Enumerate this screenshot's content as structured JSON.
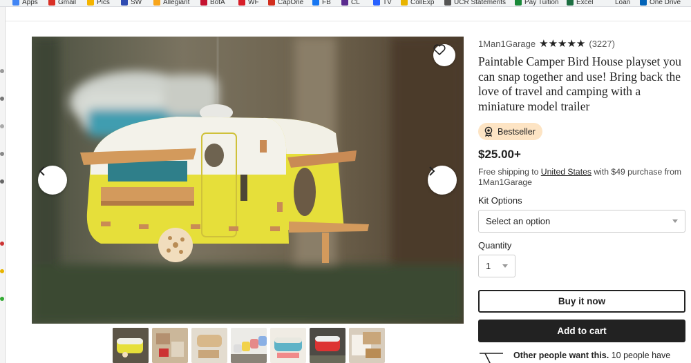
{
  "bookmarks": [
    {
      "label": "Apps",
      "icon": "apps-grid-icon",
      "color": "#4285f4"
    },
    {
      "label": "Gmail",
      "icon": "gmail-icon",
      "color": "#d93025"
    },
    {
      "label": "Pics",
      "icon": "photos-icon",
      "color": "#f4b400"
    },
    {
      "label": "SW",
      "icon": "southwest-heart-icon",
      "color": "#304cb2"
    },
    {
      "label": "Allegiant",
      "icon": "allegiant-sun-icon",
      "color": "#f8a51b"
    },
    {
      "label": "BofA",
      "icon": "bofa-flag-icon",
      "color": "#c41230"
    },
    {
      "label": "WF",
      "icon": "wf-icon",
      "color": "#d71e28"
    },
    {
      "label": "CapOne",
      "icon": "capone-swoosh-icon",
      "color": "#d22e1e"
    },
    {
      "label": "FB",
      "icon": "facebook-icon",
      "color": "#1877f2"
    },
    {
      "label": "CL",
      "icon": "peace-icon",
      "color": "#5b2c8f"
    },
    {
      "label": "TV",
      "icon": "play-icon",
      "color": "#2962ff"
    },
    {
      "label": "CollExp",
      "icon": "collexp-icon",
      "color": "#e8b400"
    },
    {
      "label": "UCR Statements",
      "icon": "globe-icon",
      "color": "#555555"
    },
    {
      "label": "Pay Tuition",
      "icon": "tuition-icon",
      "color": "#1a8a3a"
    },
    {
      "label": "Excel",
      "icon": "excel-icon",
      "color": "#1d6f42"
    },
    {
      "label": "Loan",
      "icon": "",
      "color": ""
    },
    {
      "label": "One Drive",
      "icon": "onedrive-cloud-icon",
      "color": "#0364b8"
    }
  ],
  "shop": {
    "name": "1Man1Garage",
    "stars": "★★★★★",
    "rating": 5,
    "reviews": "(3227)"
  },
  "listing": {
    "title": "Paintable Camper Bird House playset you can snap together and use! Bring back the love of travel and camping with a miniature model trailer",
    "badge": "Bestseller",
    "price": "$25.00+",
    "shipping_prefix": "Free shipping to ",
    "shipping_country": "United States",
    "shipping_suffix": " with $49 purchase from 1Man1Garage"
  },
  "options": {
    "kit_label": "Kit Options",
    "kit_value": "Select an option",
    "qty_label": "Quantity",
    "qty_value": "1"
  },
  "actions": {
    "buy_now": "Buy it now",
    "add_to_cart": "Add to cart"
  },
  "social_proof": {
    "bold": "Other people want this.",
    "text": " 10 people have"
  },
  "gallery": {
    "thumbnail_count": 7,
    "active_index": 0
  },
  "colors": {
    "badge_bg": "#fde4c4",
    "primary_button": "#222222",
    "camper_yellow": "#e6df3a"
  }
}
